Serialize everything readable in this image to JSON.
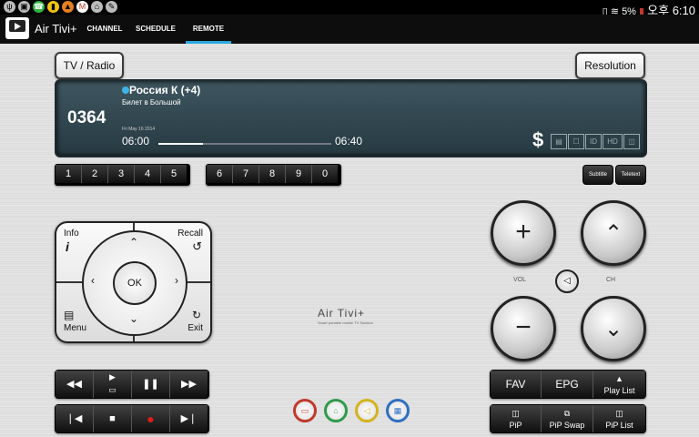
{
  "status": {
    "left_icons": [
      "usb-icon",
      "cart-icon",
      "whatsapp-icon",
      "battery-saver-icon",
      "carrot-icon",
      "gmail-icon",
      "home-icon",
      "brush-icon"
    ],
    "battery": "5%",
    "time": "오후 6:10"
  },
  "appbar": {
    "title": "Air Tivi+",
    "tabs": [
      {
        "label": "CHANNEL",
        "active": false
      },
      {
        "label": "SCHEDULE",
        "active": false
      },
      {
        "label": "REMOTE",
        "active": true
      }
    ],
    "accent": "#2aa7d9"
  },
  "top": {
    "tv_radio": "TV / Radio",
    "resolution": "Resolution"
  },
  "channel": {
    "number": "0364",
    "name": "Россия К (+4)",
    "program": "Билет в Большой",
    "date": "Fri May 16 2014",
    "start": "06:00",
    "end": "06:40",
    "progress": 0.26,
    "features": [
      "$",
      "▤",
      "☐",
      "ID",
      "HD",
      "◫"
    ]
  },
  "numbers": {
    "group1": [
      "1",
      "2",
      "3",
      "4",
      "5"
    ],
    "group2": [
      "6",
      "7",
      "8",
      "9",
      "0"
    ],
    "subtitle": "Subtitle",
    "teletext": "Teletext"
  },
  "navpad": {
    "info": "Info",
    "info_glyph": "i",
    "recall": "Recall",
    "menu": "Menu",
    "exit": "Exit",
    "ok": "OK"
  },
  "volume": {
    "label": "VOL"
  },
  "channel_ctrl": {
    "label": "CH"
  },
  "brand": {
    "name": "Air Tivi+",
    "tagline": "Smart portable mobile TV Solution"
  },
  "right_buttons": {
    "fav": "FAV",
    "epg": "EPG",
    "playlist": "Play List",
    "pip": "PiP",
    "pip_swap": "PiP Swap",
    "pip_list": "PiP List"
  },
  "color_buttons": [
    {
      "name": "red",
      "color": "#c0392b"
    },
    {
      "name": "green",
      "color": "#2e9b4b"
    },
    {
      "name": "yellow",
      "color": "#d4b31c"
    },
    {
      "name": "blue",
      "color": "#2e6fc0"
    }
  ]
}
